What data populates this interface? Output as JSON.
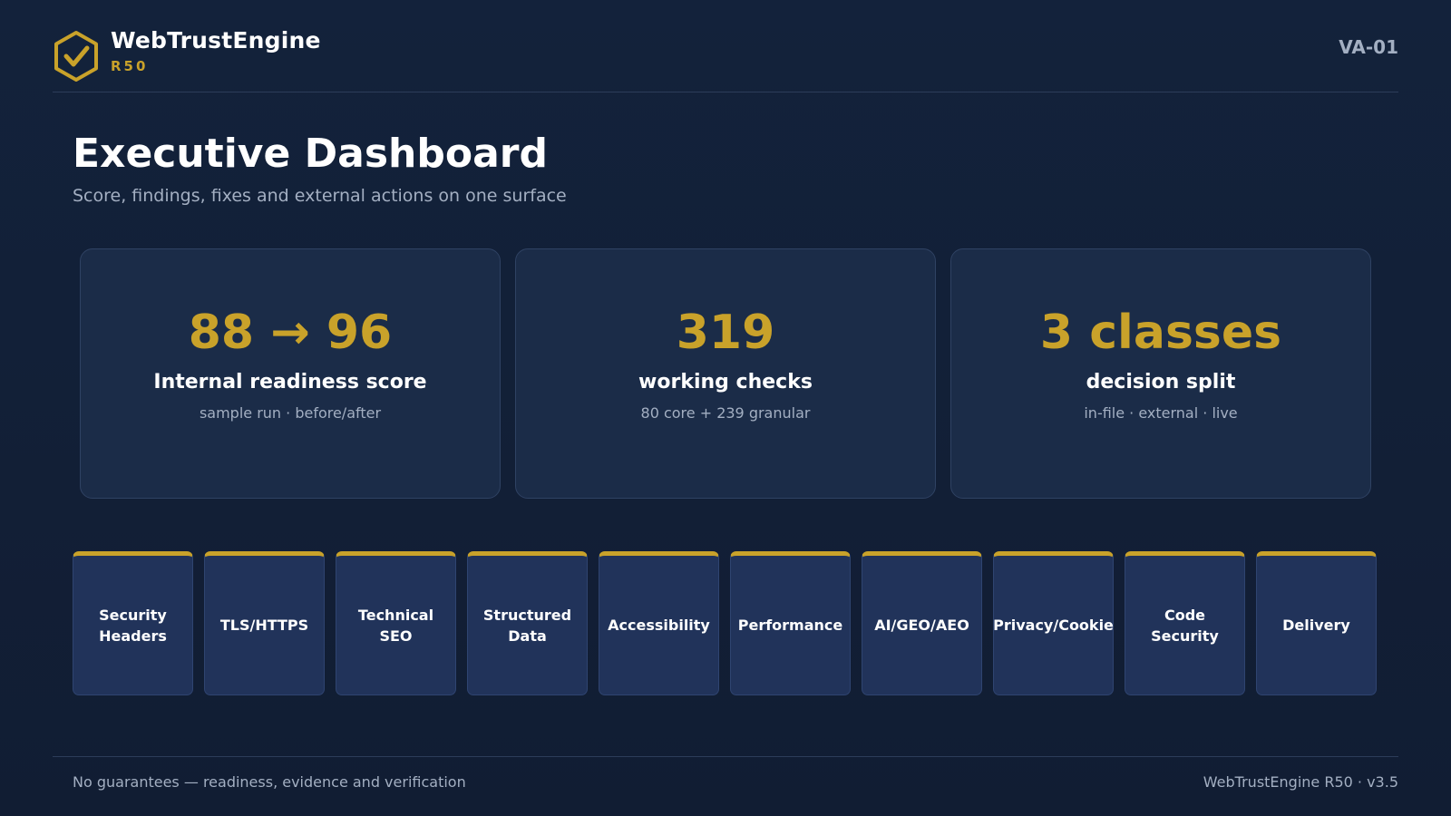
{
  "brand": {
    "name": "WebTrustEngine",
    "subtitle": "R50",
    "logo_icon": "hexagon-check-icon",
    "accent_color": "#c9a22a"
  },
  "slide_id": "VA-01",
  "page": {
    "title": "Executive Dashboard",
    "subtitle": "Score, findings, fixes and external actions on one surface"
  },
  "stats": [
    {
      "value": "88 → 96",
      "label": "Internal readiness score",
      "note": "sample run · before/after"
    },
    {
      "value": "319",
      "label": "working checks",
      "note": "80 core + 239 granular"
    },
    {
      "value": "3 classes",
      "label": "decision split",
      "note": "in-file · external · live"
    }
  ],
  "categories": [
    "Security Headers",
    "TLS/HTTPS",
    "Technical SEO",
    "Structured Data",
    "Accessibility",
    "Performance",
    "AI/GEO/AEO",
    "Privacy/Cookie",
    "Code Security",
    "Delivery"
  ],
  "footer": {
    "left": "No guarantees — readiness, evidence and verification",
    "right": "WebTrustEngine R50 · v3.5"
  }
}
